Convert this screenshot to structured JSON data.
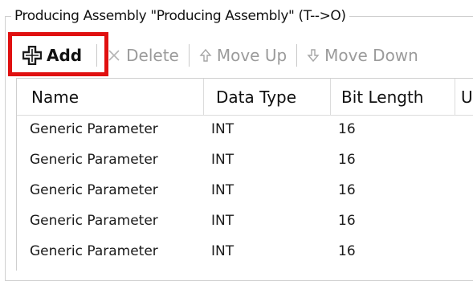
{
  "group": {
    "title": "Producing Assembly \"Producing Assembly\" (T-->O)"
  },
  "toolbar": {
    "add_label": "Add",
    "delete_label": "Delete",
    "move_up_label": "Move Up",
    "move_down_label": "Move Down"
  },
  "grid": {
    "columns": [
      "Name",
      "Data Type",
      "Bit Length",
      "U"
    ],
    "rows": [
      {
        "name": "Generic Parameter",
        "data_type": "INT",
        "bit_length": "16"
      },
      {
        "name": "Generic Parameter",
        "data_type": "INT",
        "bit_length": "16"
      },
      {
        "name": "Generic Parameter",
        "data_type": "INT",
        "bit_length": "16"
      },
      {
        "name": "Generic Parameter",
        "data_type": "INT",
        "bit_length": "16"
      },
      {
        "name": "Generic Parameter",
        "data_type": "INT",
        "bit_length": "16"
      }
    ]
  },
  "colors": {
    "highlight": "#e01010",
    "disabled_text": "#9b9b9b"
  },
  "icons": {
    "add": "plus-icon",
    "delete": "delete-x-icon",
    "move_up": "arrow-up-icon",
    "move_down": "arrow-down-icon"
  }
}
